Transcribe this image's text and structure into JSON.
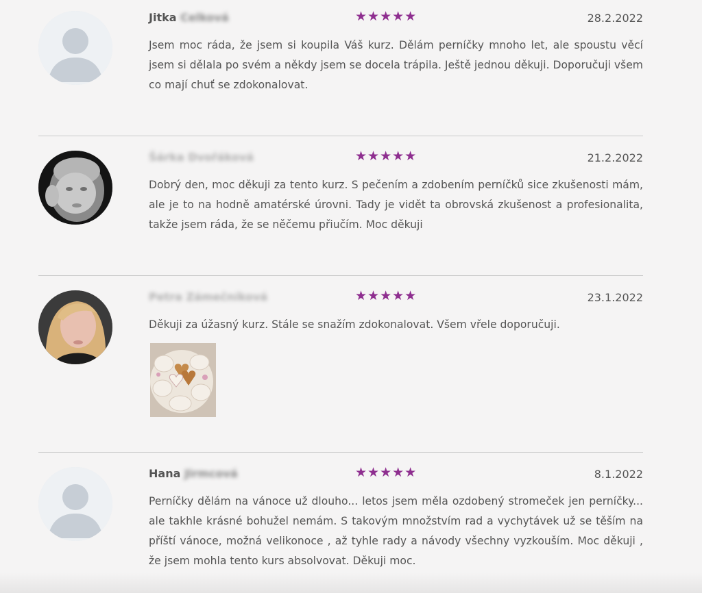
{
  "reviews": [
    {
      "first_name": "Jitka",
      "last_name": "Celková",
      "stars": "★★★★★",
      "rating": 5,
      "date": "28.2.2022",
      "text": "Jsem moc ráda, že jsem si koupila Váš kurz. Dělám perníčky mnoho let, ale spoustu věcí jsem si dělala po svém a někdy jsem se docela trápila. Ještě jednou děkuji. Doporučuji všem co mají chuť se zdokonalovat.",
      "avatar": "default-user-icon"
    },
    {
      "first_name": "",
      "last_name": "Šárka Dvořáková",
      "stars": "★★★★★",
      "rating": 5,
      "date": "21.2.2022",
      "text": "Dobrý den, moc děkuji za tento kurz. S pečením a zdobením perníčků sice zkušenosti mám, ale je to na hodně amatérské úrovni. Tady je vidět ta obrovská zkušenost a profesionalita, takže jsem ráda, že se něčemu přiučím. Moc děkuji",
      "avatar": "baby-photo"
    },
    {
      "first_name": "",
      "last_name": "Petra Zámečníková",
      "stars": "★★★★★",
      "rating": 5,
      "date": "23.1.2022",
      "text": "Děkuji za úžasný kurz. Stále se snažím zdokonalovat. Všem vřele doporučuji.",
      "avatar": "woman-photo",
      "attachment": "gingerbread-hearts-photo"
    },
    {
      "first_name": "Hana",
      "last_name": "Jirmcová",
      "stars": "★★★★★",
      "rating": 5,
      "date": "8.1.2022",
      "text": "Perníčky dělám na vánoce už dlouho... letos jsem měla ozdobený stromeček jen perníčky... ale takhle krásné bohužel nemám. S takovým množstvím rad a vychytávek už se těším na příští vánoce, možná velikonoce , až tyhle rady a návody všechny vyzkouším. Moc děkuji , že jsem mohla tento kurs absolvovat. Děkuji moc.",
      "avatar": "default-user-icon"
    }
  ],
  "colors": {
    "star": "#8e2e8f",
    "text": "#555555",
    "background": "#f5f4f4",
    "divider": "#c9c9c9"
  }
}
